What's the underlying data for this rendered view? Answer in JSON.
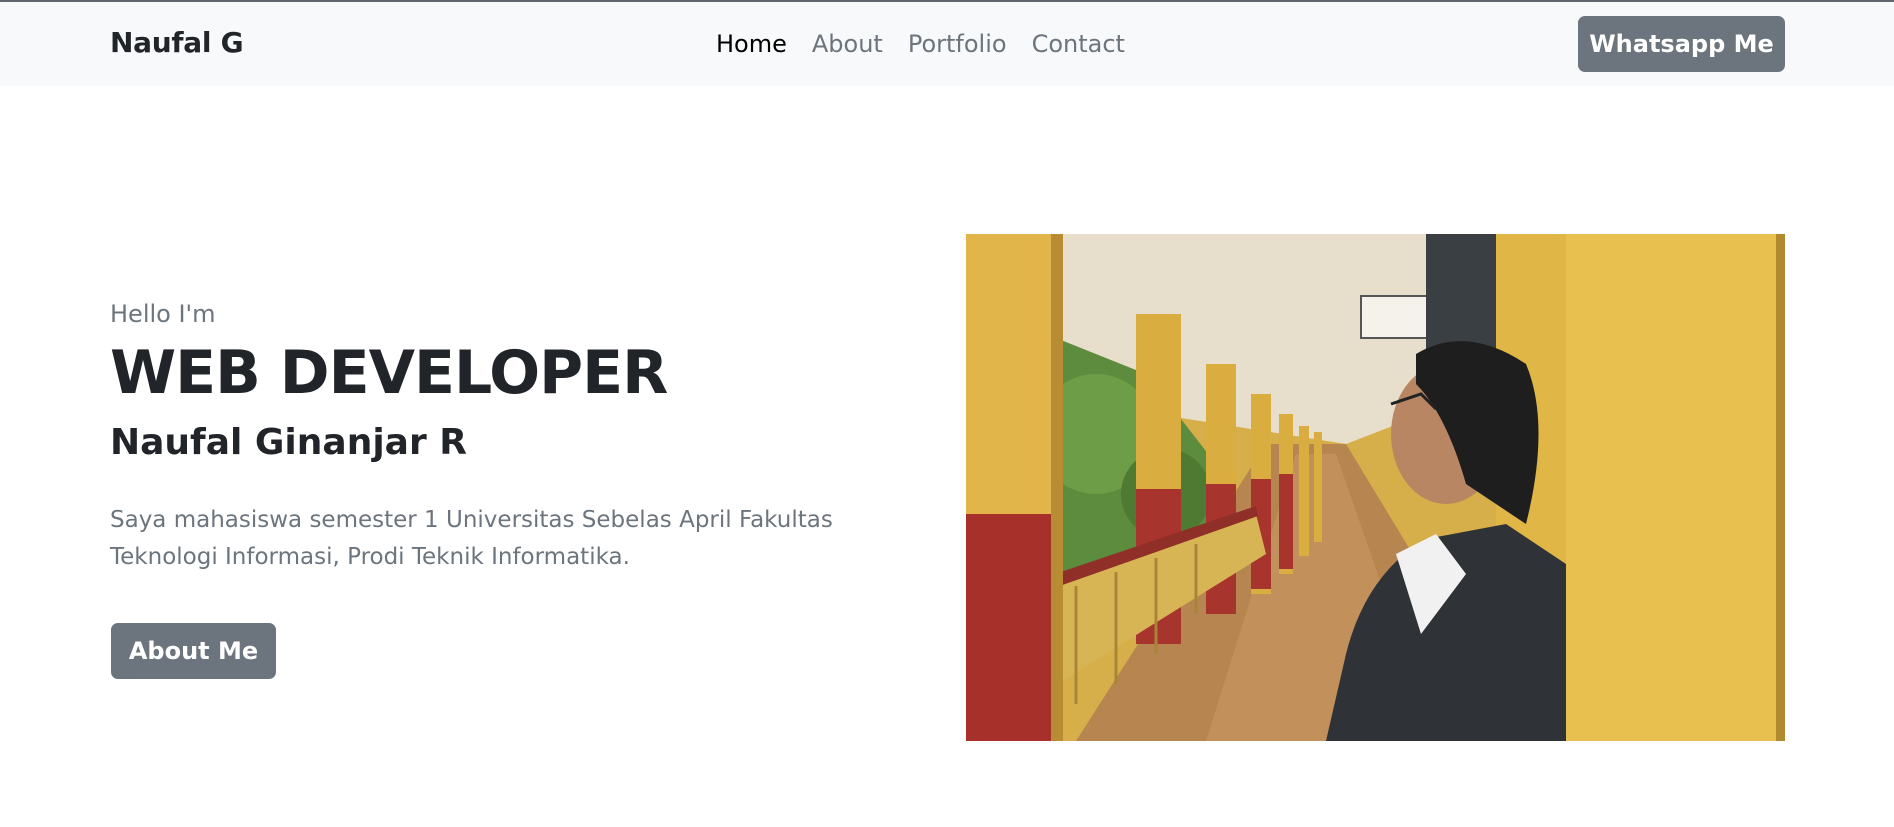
{
  "navbar": {
    "brand": "Naufal G",
    "links": [
      {
        "label": "Home",
        "active": true
      },
      {
        "label": "About",
        "active": false
      },
      {
        "label": "Portfolio",
        "active": false
      },
      {
        "label": "Contact",
        "active": false
      }
    ],
    "cta_label": "Whatsapp Me"
  },
  "hero": {
    "greeting": "Hello I'm",
    "headline": "WEB DEVELOPER",
    "name": "Naufal Ginanjar R",
    "bio": "Saya mahasiswa semester 1 Universitas Sebelas April Fakultas Teknologi Informasi, Prodi Teknik Informatika.",
    "button_label": "About Me"
  },
  "colors": {
    "navbar_bg": "#f8f9fa",
    "button_bg": "#6c757d",
    "text_dark": "#212529",
    "text_muted": "#6c757d"
  }
}
